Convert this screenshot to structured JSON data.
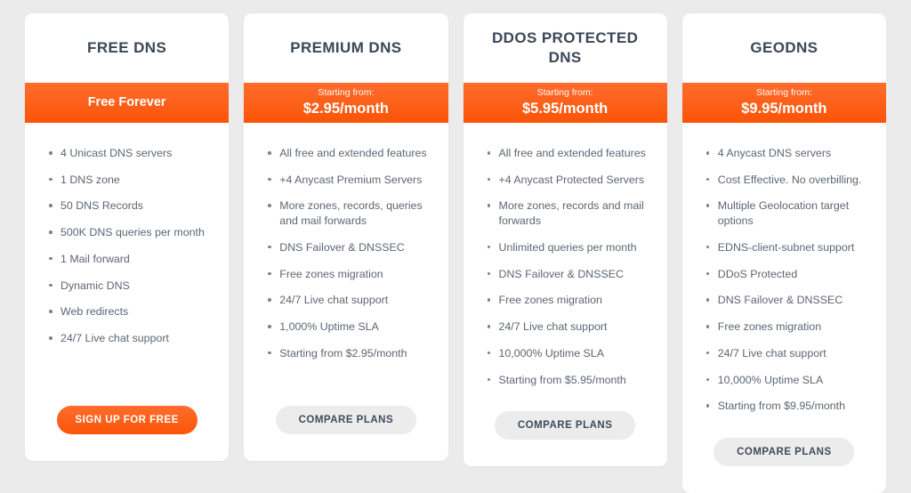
{
  "theme": {
    "page_background": "#ebebeb",
    "card_background": "#ffffff",
    "accent_orange": "#fb5408",
    "accent_orange_light": "#ff6d2d",
    "title_color": "#3c4757",
    "feature_text_color": "#5c6672",
    "secondary_button_background": "#ececec",
    "secondary_button_text": "#404a5c"
  },
  "plans": [
    {
      "title": "FREE DNS",
      "band_type": "single",
      "band_label": "Free Forever",
      "price_caption": "",
      "price_value": "",
      "features": [
        "4 Unicast DNS servers",
        "1 DNS zone",
        "50 DNS Records",
        "500K DNS queries per month",
        "1 Mail forward",
        "Dynamic DNS",
        "Web redirects",
        "24/7 Live chat support"
      ],
      "cta_label": "SIGN UP FOR FREE",
      "cta_style": "primary"
    },
    {
      "title": "PREMIUM DNS",
      "band_type": "price",
      "band_label": "",
      "price_caption": "Starting from:",
      "price_value": "$2.95/month",
      "features": [
        "All free and extended features",
        "+4 Anycast Premium Servers",
        "More zones, records, queries and mail forwards",
        "DNS Failover & DNSSEC",
        "Free zones migration",
        "24/7 Live chat support",
        "1,000% Uptime SLA",
        "Starting from $2.95/month"
      ],
      "cta_label": "COMPARE PLANS",
      "cta_style": "secondary"
    },
    {
      "title": "DDOS PROTECTED DNS",
      "band_type": "price",
      "band_label": "",
      "price_caption": "Starting from:",
      "price_value": "$5.95/month",
      "features": [
        "All free and extended features",
        "+4 Anycast Protected Servers",
        "More zones, records and mail forwards",
        "Unlimited queries per month",
        "DNS Failover & DNSSEC",
        "Free zones migration",
        "24/7 Live chat support",
        "10,000% Uptime SLA",
        "Starting from $5.95/month"
      ],
      "cta_label": "COMPARE PLANS",
      "cta_style": "secondary"
    },
    {
      "title": "GEODNS",
      "band_type": "price",
      "band_label": "",
      "price_caption": "Starting from:",
      "price_value": "$9.95/month",
      "features": [
        "4 Anycast DNS servers",
        "Cost Effective. No overbilling.",
        "Multiple Geolocation target options",
        "EDNS-client-subnet support",
        "DDoS Protected",
        "DNS Failover & DNSSEC",
        "Free zones migration",
        "24/7 Live chat support",
        "10,000% Uptime SLA",
        "Starting from $9.95/month"
      ],
      "cta_label": "COMPARE PLANS",
      "cta_style": "secondary"
    }
  ]
}
